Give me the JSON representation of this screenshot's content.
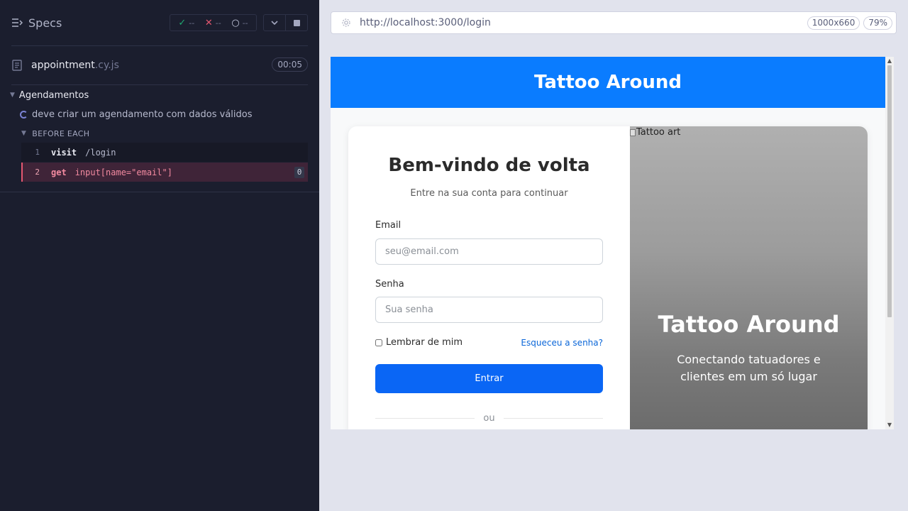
{
  "runner": {
    "specs_label": "Specs",
    "stats": {
      "passed": "--",
      "failed": "--",
      "pending": "--"
    },
    "spec_file": {
      "name": "appointment",
      "ext": ".cy.js",
      "duration": "00:05"
    },
    "suite_title": "Agendamentos",
    "test_title": "deve criar um agendamento com dados válidos",
    "hook_title": "BEFORE EACH",
    "commands": [
      {
        "number": "1",
        "name": "visit",
        "message": "/login"
      },
      {
        "number": "2",
        "name": "get",
        "message": "input[name=\"email\"]",
        "count": "0"
      }
    ],
    "colors": {
      "background": "#1b1e2e",
      "failed": "#e45770",
      "passed": "#1fa971"
    }
  },
  "aut": {
    "url": "http://localhost:3000/login",
    "viewport": "1000x660",
    "zoom": "79%",
    "app_header": "Tattoo Around",
    "login": {
      "title": "Bem-vindo de volta",
      "subtitle": "Entre na sua conta para continuar",
      "email_label": "Email",
      "email_placeholder": "seu@email.com",
      "password_label": "Senha",
      "password_placeholder": "Sua senha",
      "remember_label": "Lembrar de mim",
      "forgot_label": "Esqueceu a senha?",
      "submit_label": "Entrar",
      "divider_label": "ou"
    },
    "hero": {
      "image_alt": "Tattoo art",
      "title": "Tattoo Around",
      "subtitle": "Conectando tatuadores e clientes em um só lugar"
    },
    "colors": {
      "brand": "#0a7cff",
      "button": "#0a66f5",
      "link": "#0a66d8"
    }
  }
}
